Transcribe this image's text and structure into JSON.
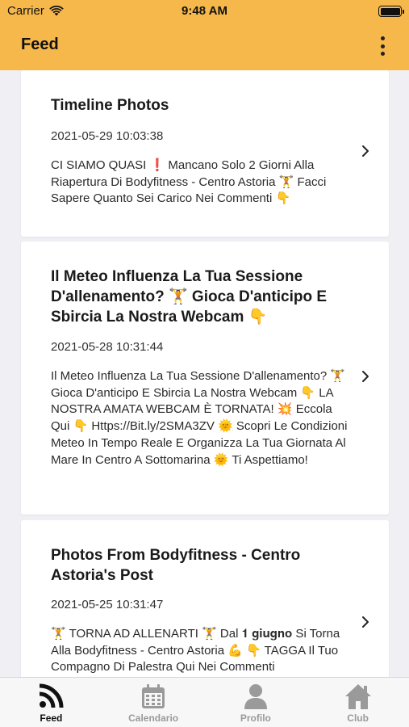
{
  "status_bar": {
    "carrier": "Carrier",
    "time": "9:48 AM"
  },
  "header": {
    "title": "Feed",
    "more_icon": "more-vertical-icon"
  },
  "posts": [
    {
      "title": "Timeline Photos",
      "date": "2021-05-29 10:03:38",
      "body": "CI SIAMO QUASI ❗️ Mancano Solo 2 Giorni Alla Riapertura Di Bodyfitness - Centro Astoria 🏋️ Facci Sapere Quanto Sei Carico Nei Commenti 👇"
    },
    {
      "title": "Il Meteo Influenza La Tua Sessione D'allenamento? 🏋️ Gioca D'anticipo E Sbircia La Nostra Webcam 👇",
      "date": "2021-05-28 10:31:44",
      "body": "Il Meteo Influenza La Tua Sessione D'allenamento? 🏋️ Gioca D'anticipo E Sbircia La Nostra Webcam 👇 LA NOSTRA AMATA WEBCAM È TORNATA! 💥 Eccola Qui 👇 Https://Bit.ly/2SMA3ZV 🌞 Scopri Le Condizioni Meteo In Tempo Reale E Organizza La Tua Giornata Al Mare In Centro A Sottomarina 🌞 Ti Aspettiamo!"
    },
    {
      "title": "Photos From Bodyfitness - Centro Astoria's Post",
      "date": "2021-05-25 10:31:47",
      "body": "🏋️ TORNA AD ALLENARTI 🏋️ Dal 𝟏 𝐠𝐢𝐮𝐠𝐧𝐨 Si Torna Alla Bodyfitness - Centro Astoria 💪 👇 TAGGA Il Tuo Compagno Di Palestra Qui Nei Commenti"
    }
  ],
  "tabbar": {
    "tabs": [
      {
        "label": "Feed",
        "icon": "rss-feed-icon",
        "active": true
      },
      {
        "label": "Calendario",
        "icon": "calendar-icon",
        "active": false
      },
      {
        "label": "Profilo",
        "icon": "user-icon",
        "active": false
      },
      {
        "label": "Club",
        "icon": "home-icon",
        "active": false
      }
    ]
  },
  "colors": {
    "header": "#f6b84b",
    "background": "#efeff4",
    "active_tab": "#111111",
    "inactive_tab": "#9a9a9a"
  }
}
